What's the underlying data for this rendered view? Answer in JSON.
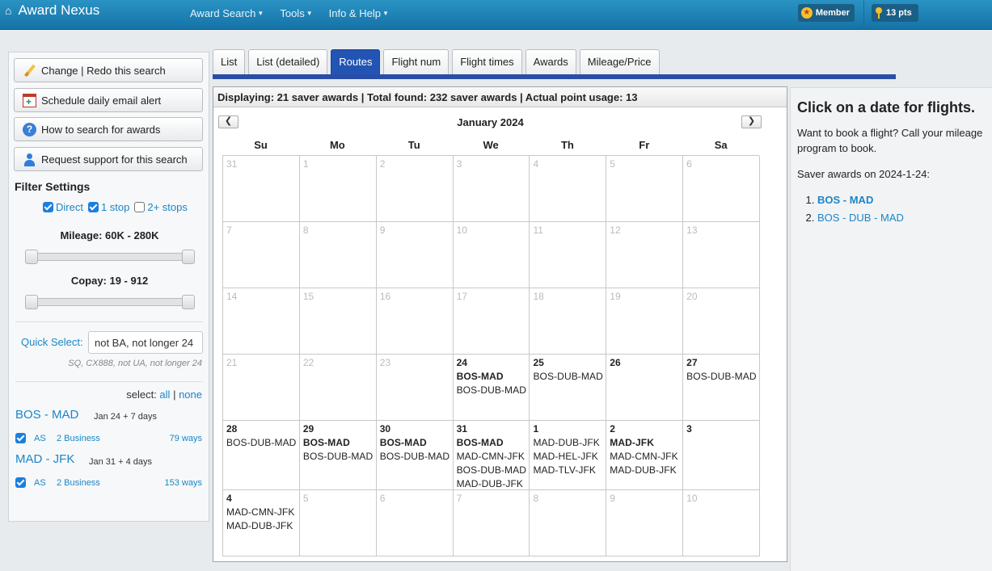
{
  "nav": {
    "brand": "Award Nexus",
    "menus": [
      "Award Search",
      "Tools",
      "Info & Help"
    ],
    "member": "Member",
    "points": "13 pts"
  },
  "sidebar": {
    "buttons": [
      "Change | Redo this search",
      "Schedule daily email alert",
      "How to search for awards",
      "Request support for this search"
    ],
    "filter_title": "Filter Settings",
    "stops": [
      {
        "label": "Direct",
        "checked": true
      },
      {
        "label": "1 stop",
        "checked": true
      },
      {
        "label": "2+ stops",
        "checked": false
      }
    ],
    "mileage_label": "Mileage: 60K - 280K",
    "copay_label": "Copay: 19 - 912",
    "quick_select_label": "Quick Select:",
    "quick_select_value": "not BA, not longer 24",
    "quick_select_hint": "SQ, CX888, not UA, not longer 24",
    "select_label": "select:",
    "select_all": "all",
    "select_sep": "|",
    "select_none": "none",
    "routes": [
      {
        "title": "BOS - MAD",
        "meta": "Jan 24 + 7 days",
        "airline": "AS",
        "cabin": "2 Business",
        "ways": "79 ways"
      },
      {
        "title": "MAD - JFK",
        "meta": "Jan 31 + 4 days",
        "airline": "AS",
        "cabin": "2 Business",
        "ways": "153 ways"
      }
    ]
  },
  "tabs": [
    "List",
    "List (detailed)",
    "Routes",
    "Flight num",
    "Flight times",
    "Awards",
    "Mileage/Price"
  ],
  "active_tab": "Routes",
  "calendar": {
    "display_text": "Displaying: 21 saver awards | Total found: 232 saver awards | Actual point usage: 13",
    "prev": "<",
    "next": ">",
    "month": "January 2024",
    "days": [
      "Su",
      "Mo",
      "Tu",
      "We",
      "Th",
      "Fr",
      "Sa"
    ],
    "cells": [
      {
        "d": "31",
        "cur": false,
        "routes": []
      },
      {
        "d": "1",
        "cur": false,
        "routes": []
      },
      {
        "d": "2",
        "cur": false,
        "routes": []
      },
      {
        "d": "3",
        "cur": false,
        "routes": []
      },
      {
        "d": "4",
        "cur": false,
        "routes": []
      },
      {
        "d": "5",
        "cur": false,
        "routes": []
      },
      {
        "d": "6",
        "cur": false,
        "routes": []
      },
      {
        "d": "7",
        "cur": false,
        "routes": []
      },
      {
        "d": "8",
        "cur": false,
        "routes": []
      },
      {
        "d": "9",
        "cur": false,
        "routes": []
      },
      {
        "d": "10",
        "cur": false,
        "routes": []
      },
      {
        "d": "11",
        "cur": false,
        "routes": []
      },
      {
        "d": "12",
        "cur": false,
        "routes": []
      },
      {
        "d": "13",
        "cur": false,
        "routes": []
      },
      {
        "d": "14",
        "cur": false,
        "routes": []
      },
      {
        "d": "15",
        "cur": false,
        "routes": []
      },
      {
        "d": "16",
        "cur": false,
        "routes": []
      },
      {
        "d": "17",
        "cur": false,
        "routes": []
      },
      {
        "d": "18",
        "cur": false,
        "routes": []
      },
      {
        "d": "19",
        "cur": false,
        "routes": []
      },
      {
        "d": "20",
        "cur": false,
        "routes": []
      },
      {
        "d": "21",
        "cur": false,
        "routes": []
      },
      {
        "d": "22",
        "cur": false,
        "routes": []
      },
      {
        "d": "23",
        "cur": false,
        "routes": []
      },
      {
        "d": "24",
        "cur": true,
        "routes": [
          {
            "t": "BOS-MAD",
            "b": true
          },
          {
            "t": "BOS-DUB-MAD",
            "b": false
          }
        ]
      },
      {
        "d": "25",
        "cur": true,
        "routes": [
          {
            "t": "BOS-DUB-MAD",
            "b": false
          }
        ]
      },
      {
        "d": "26",
        "cur": true,
        "routes": []
      },
      {
        "d": "27",
        "cur": true,
        "routes": [
          {
            "t": "BOS-DUB-MAD",
            "b": false
          }
        ]
      },
      {
        "d": "28",
        "cur": true,
        "routes": [
          {
            "t": "BOS-DUB-MAD",
            "b": false
          }
        ]
      },
      {
        "d": "29",
        "cur": true,
        "routes": [
          {
            "t": "BOS-MAD",
            "b": true
          },
          {
            "t": "BOS-DUB-MAD",
            "b": false
          }
        ]
      },
      {
        "d": "30",
        "cur": true,
        "routes": [
          {
            "t": "BOS-MAD",
            "b": true
          },
          {
            "t": "BOS-DUB-MAD",
            "b": false
          }
        ]
      },
      {
        "d": "31",
        "cur": true,
        "routes": [
          {
            "t": "BOS-MAD",
            "b": true
          },
          {
            "t": "MAD-CMN-JFK",
            "b": false
          },
          {
            "t": "BOS-DUB-MAD",
            "b": false
          },
          {
            "t": "MAD-DUB-JFK",
            "b": false
          }
        ]
      },
      {
        "d": "1",
        "cur": true,
        "routes": [
          {
            "t": "MAD-DUB-JFK",
            "b": false
          },
          {
            "t": "MAD-HEL-JFK",
            "b": false
          },
          {
            "t": "MAD-TLV-JFK",
            "b": false
          }
        ]
      },
      {
        "d": "2",
        "cur": true,
        "routes": [
          {
            "t": "MAD-JFK",
            "b": true
          },
          {
            "t": "MAD-CMN-JFK",
            "b": false
          },
          {
            "t": "MAD-DUB-JFK",
            "b": false
          }
        ]
      },
      {
        "d": "3",
        "cur": true,
        "routes": []
      },
      {
        "d": "4",
        "cur": true,
        "routes": [
          {
            "t": "MAD-CMN-JFK",
            "b": false
          },
          {
            "t": "MAD-DUB-JFK",
            "b": false
          }
        ]
      },
      {
        "d": "5",
        "cur": false,
        "routes": []
      },
      {
        "d": "6",
        "cur": false,
        "routes": []
      },
      {
        "d": "7",
        "cur": false,
        "routes": []
      },
      {
        "d": "8",
        "cur": false,
        "routes": []
      },
      {
        "d": "9",
        "cur": false,
        "routes": []
      },
      {
        "d": "10",
        "cur": false,
        "routes": []
      }
    ]
  },
  "right": {
    "title": "Click on a date for flights.",
    "text": "Want to book a flight? Call your mileage program to book.",
    "sub": "Saver awards on 2024-1-24:",
    "items": [
      {
        "label": "BOS - MAD",
        "bold": true
      },
      {
        "label": "BOS - DUB - MAD",
        "bold": false
      }
    ]
  }
}
